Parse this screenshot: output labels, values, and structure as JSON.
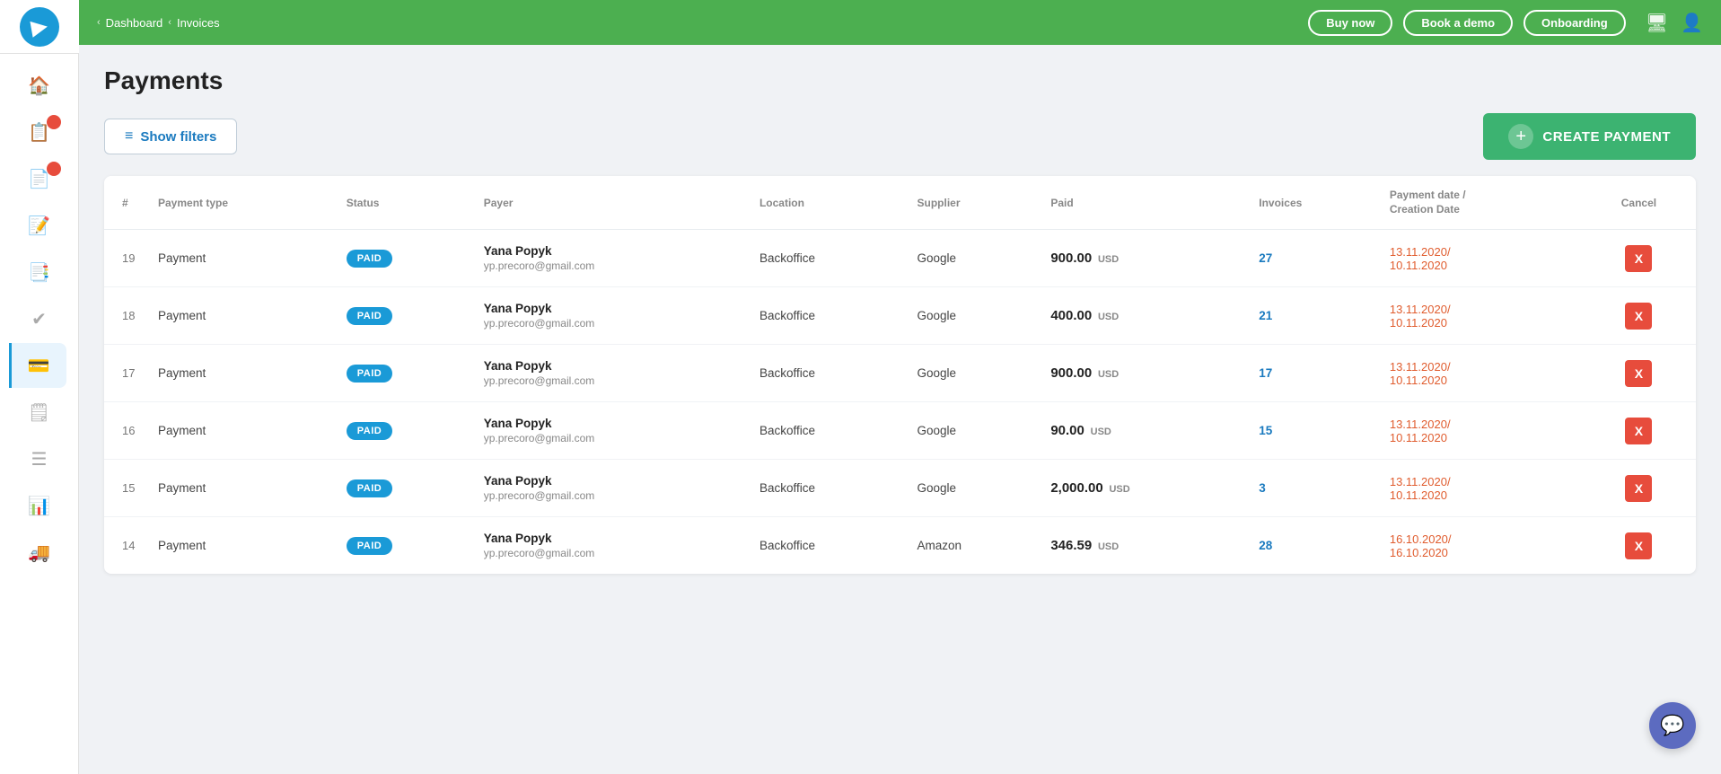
{
  "app": {
    "logo_label": "Precoro"
  },
  "topbar": {
    "breadcrumb": [
      {
        "label": "Dashboard",
        "arrow": "‹"
      },
      {
        "label": "Invoices",
        "arrow": "‹"
      }
    ],
    "buttons": [
      {
        "label": "Buy now"
      },
      {
        "label": "Book a demo"
      },
      {
        "label": "Onboarding"
      }
    ]
  },
  "page": {
    "title": "Payments",
    "show_filters_label": "Show filters",
    "create_payment_label": "CREATE PAYMENT"
  },
  "table": {
    "columns": [
      {
        "label": "#"
      },
      {
        "label": "Payment type"
      },
      {
        "label": "Status"
      },
      {
        "label": "Payer"
      },
      {
        "label": "Location"
      },
      {
        "label": "Supplier"
      },
      {
        "label": "Paid"
      },
      {
        "label": "Invoices"
      },
      {
        "label": "Payment date /\nCreation Date"
      },
      {
        "label": "Cancel"
      }
    ],
    "rows": [
      {
        "id": "19",
        "payment_type": "Payment",
        "status": "PAID",
        "payer_name": "Yana Popyk",
        "payer_email": "yp.precoro@gmail.com",
        "location": "Backoffice",
        "supplier": "Google",
        "amount": "900.00",
        "currency": "USD",
        "invoices": "27",
        "payment_date": "13.11.2020/",
        "creation_date": "10.11.2020"
      },
      {
        "id": "18",
        "payment_type": "Payment",
        "status": "PAID",
        "payer_name": "Yana Popyk",
        "payer_email": "yp.precoro@gmail.com",
        "location": "Backoffice",
        "supplier": "Google",
        "amount": "400.00",
        "currency": "USD",
        "invoices": "21",
        "payment_date": "13.11.2020/",
        "creation_date": "10.11.2020"
      },
      {
        "id": "17",
        "payment_type": "Payment",
        "status": "PAID",
        "payer_name": "Yana Popyk",
        "payer_email": "yp.precoro@gmail.com",
        "location": "Backoffice",
        "supplier": "Google",
        "amount": "900.00",
        "currency": "USD",
        "invoices": "17",
        "payment_date": "13.11.2020/",
        "creation_date": "10.11.2020"
      },
      {
        "id": "16",
        "payment_type": "Payment",
        "status": "PAID",
        "payer_name": "Yana Popyk",
        "payer_email": "yp.precoro@gmail.com",
        "location": "Backoffice",
        "supplier": "Google",
        "amount": "90.00",
        "currency": "USD",
        "invoices": "15",
        "payment_date": "13.11.2020/",
        "creation_date": "10.11.2020"
      },
      {
        "id": "15",
        "payment_type": "Payment",
        "status": "PAID",
        "payer_name": "Yana Popyk",
        "payer_email": "yp.precoro@gmail.com",
        "location": "Backoffice",
        "supplier": "Google",
        "amount": "2,000.00",
        "currency": "USD",
        "invoices": "3",
        "payment_date": "13.11.2020/",
        "creation_date": "10.11.2020"
      },
      {
        "id": "14",
        "payment_type": "Payment",
        "status": "PAID",
        "payer_name": "Yana Popyk",
        "payer_email": "yp.precoro@gmail.com",
        "location": "Backoffice",
        "supplier": "Amazon",
        "amount": "346.59",
        "currency": "USD",
        "invoices": "28",
        "payment_date": "16.10.2020/",
        "creation_date": "16.10.2020"
      }
    ]
  },
  "sidebar": {
    "items": [
      {
        "icon": "🏠",
        "name": "home",
        "active": false
      },
      {
        "icon": "📋",
        "name": "orders",
        "active": false,
        "badge": ""
      },
      {
        "icon": "📄",
        "name": "invoices",
        "active": false,
        "badge": ""
      },
      {
        "icon": "📝",
        "name": "documents",
        "active": false
      },
      {
        "icon": "📑",
        "name": "reports",
        "active": false
      },
      {
        "icon": "✔",
        "name": "approvals",
        "active": false
      },
      {
        "icon": "💳",
        "name": "payments",
        "active": true
      },
      {
        "icon": "🗒",
        "name": "notes",
        "active": false
      },
      {
        "icon": "☰",
        "name": "menu",
        "active": false
      },
      {
        "icon": "📊",
        "name": "analytics",
        "active": false
      },
      {
        "icon": "🚚",
        "name": "delivery",
        "active": false
      }
    ]
  },
  "chat": {
    "icon": "💬"
  }
}
